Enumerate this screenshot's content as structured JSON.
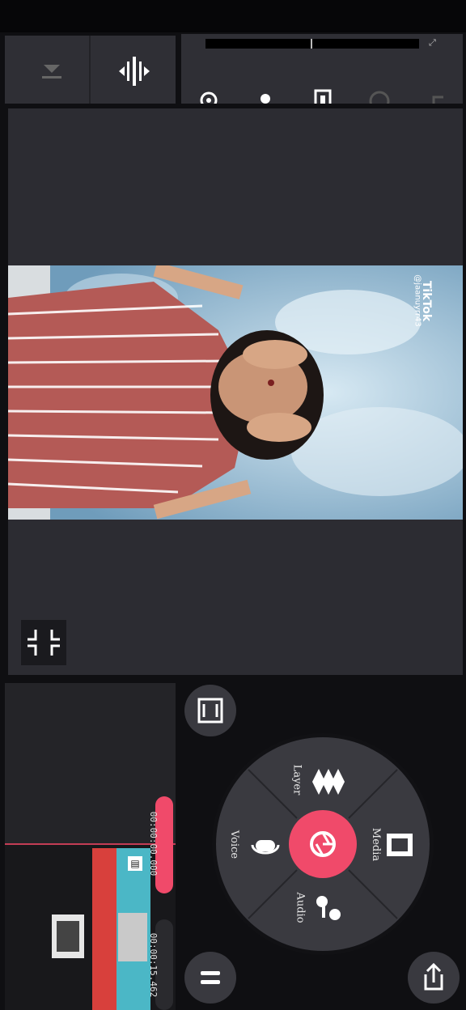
{
  "watermark": {
    "brand": "TikTok",
    "handle": "@jaanuyrr43"
  },
  "timeline": {
    "current_time": "00:00:00.000",
    "total_time": "00:00:15.462"
  },
  "wheel": {
    "media_label": "Media",
    "layer_label": "Layer",
    "voice_label": "Voice",
    "audio_label": "Audio"
  },
  "icons": {
    "lower": "lower-icon",
    "split": "split-icon",
    "settings": "gear-icon",
    "keyframe": "keyframe-icon",
    "crop": "crop-icon",
    "redo": "redo-icon",
    "undo": "undo-icon",
    "collapse": "collapse-icon",
    "record": "camera-shutter-icon",
    "export": "share-icon"
  },
  "colors": {
    "accent": "#f04a6a",
    "panel": "#2b2b31",
    "background": "#0f0f12"
  }
}
